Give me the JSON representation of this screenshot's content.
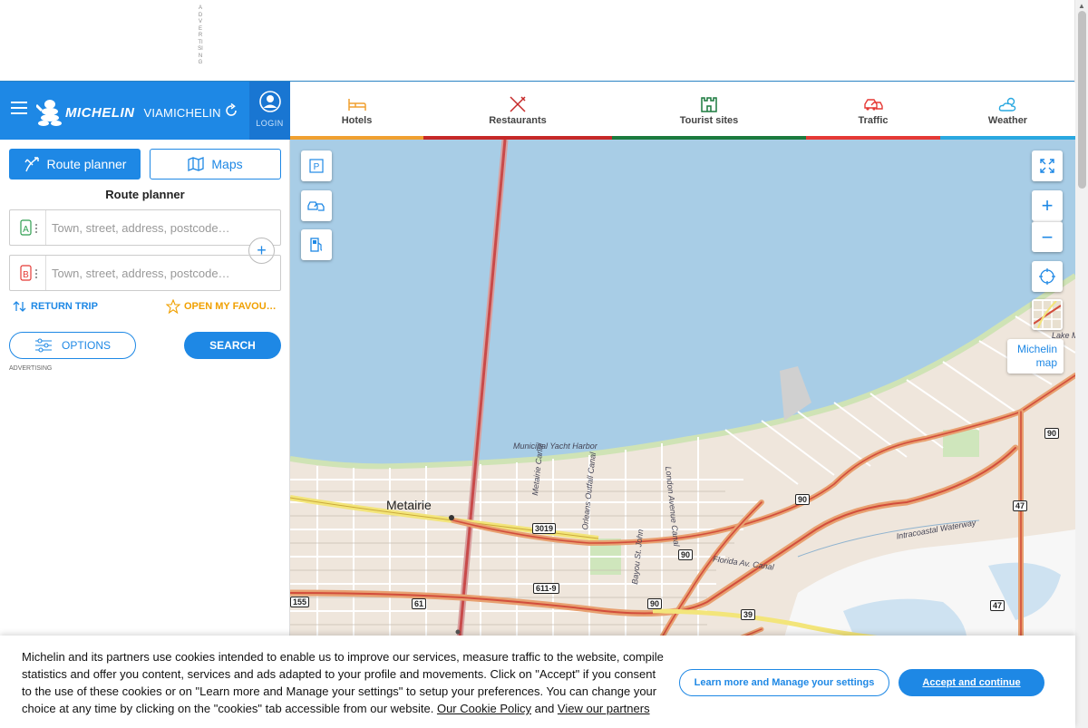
{
  "ad_strip": {
    "vertical_text": "ADVERTISING"
  },
  "header": {
    "brand": "MICHELIN",
    "product": "VIAMICHELIN",
    "login_label": "LOGIN",
    "icons": {
      "menu": "menu-icon",
      "refresh": "refresh-icon",
      "login": "user-avatar-icon"
    }
  },
  "categories": [
    {
      "label": "Hotels",
      "icon": "bed-icon",
      "color": "#f0a030"
    },
    {
      "label": "Restaurants",
      "icon": "cutlery-icon",
      "color": "#c62828"
    },
    {
      "label": "Tourist sites",
      "icon": "castle-icon",
      "color": "#1b7a3e"
    },
    {
      "label": "Traffic",
      "icon": "car-crash-icon",
      "color": "#e53935"
    },
    {
      "label": "Weather",
      "icon": "cloud-sun-icon",
      "color": "#29a8e0"
    }
  ],
  "panel": {
    "route_planner_label": "Route planner",
    "maps_label": "Maps",
    "title": "Route planner",
    "from": {
      "marker": "A",
      "placeholder": "Town, street, address, postcode…",
      "value": ""
    },
    "to": {
      "marker": "B",
      "placeholder": "Town, street, address, postcode…",
      "value": ""
    },
    "add_step": "+",
    "return_trip": "RETURN TRIP",
    "favourites": "OPEN MY FAVOU…",
    "options": "OPTIONS",
    "search": "SEARCH",
    "advertising": "ADVERTISING",
    "accent_color": "#1e88e5"
  },
  "map": {
    "controls": {
      "parking": "P",
      "zoom_in": "+",
      "zoom_out": "−",
      "michelin_map": "Michelin map"
    },
    "labels": {
      "city": "Metairie",
      "yacht_harbor": "Municipal Yacht Harbor",
      "metairie_canal": "Metairie Canal",
      "orleans_canal": "Orleans Outfall Canal",
      "london_canal": "London Avenue Canal",
      "bayou": "Bayou St. John",
      "florida_canal": "Florida Av. Canal",
      "intracoastal": "Intracoastal Waterway",
      "lake": "Lake M"
    },
    "shields": [
      "3019",
      "90",
      "90",
      "90",
      "90",
      "47",
      "47",
      "611-9",
      "61",
      "155",
      "39"
    ]
  },
  "cookie": {
    "text": "Michelin and its partners use cookies intended to enable us to improve our services, measure traffic to the website, compile statistics and offer you content, services and ads adapted to your profile and movements. Click on \"Accept\" if you consent to the use of these cookies or on \"Learn more and Manage your settings\" to setup your preferences. You can change your choice at any time by clicking on the \"cookies\" tab accessible from our website. ",
    "policy_link": "Our Cookie Policy",
    "and": " and ",
    "partners_link": "View our partners",
    "learn_more": "Learn more and Manage your settings",
    "accept": "Accept and continue"
  }
}
